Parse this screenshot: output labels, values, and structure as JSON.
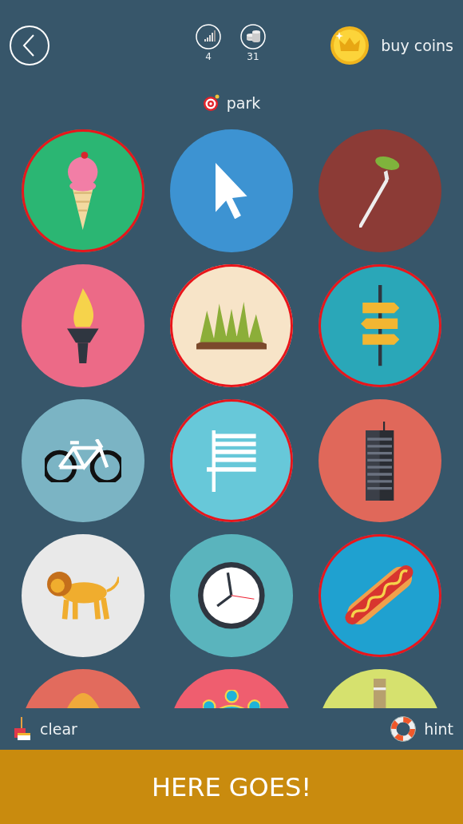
{
  "header": {
    "stats": [
      {
        "kind": "level",
        "value": "4"
      },
      {
        "kind": "coins",
        "value": "31"
      }
    ],
    "buy_label": "buy coins"
  },
  "category": "park",
  "tiles": [
    {
      "kind": "ice-cream",
      "color": "#2bb673",
      "selected": true
    },
    {
      "kind": "cursor",
      "color": "#3d93d2",
      "selected": false
    },
    {
      "kind": "fork",
      "color": "#8c3b36",
      "selected": false
    },
    {
      "kind": "torch",
      "color": "#ec6a87",
      "selected": false
    },
    {
      "kind": "grass",
      "color": "#f7e4c8",
      "selected": true
    },
    {
      "kind": "signpost",
      "color": "#2aa7b8",
      "selected": true
    },
    {
      "kind": "bicycle",
      "color": "#7bb4c4",
      "selected": false
    },
    {
      "kind": "bench",
      "color": "#67c8d9",
      "selected": true
    },
    {
      "kind": "building",
      "color": "#e0685a",
      "selected": false
    },
    {
      "kind": "lion",
      "color": "#e9e9e9",
      "selected": false
    },
    {
      "kind": "clock",
      "color": "#5ab4bd",
      "selected": false
    },
    {
      "kind": "hotdog",
      "color": "#1fa1d0",
      "selected": true
    },
    {
      "kind": "hill",
      "color": "#e26b5d",
      "selected": false
    },
    {
      "kind": "people",
      "color": "#ef5e6f",
      "selected": false
    },
    {
      "kind": "tower",
      "color": "#d6e16e",
      "selected": false
    }
  ],
  "footer": {
    "clear_label": "clear",
    "hint_label": "hint"
  },
  "submit_label": "HERE GOES!"
}
